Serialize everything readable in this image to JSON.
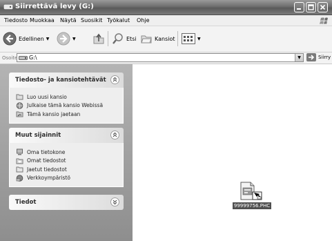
{
  "window": {
    "title": "Siirrettävä levy (G:)"
  },
  "menubar": {
    "items": [
      "Tiedosto",
      "Muokkaa",
      "Näytä",
      "Suosikit",
      "Työkalut",
      "Ohje"
    ]
  },
  "toolbar": {
    "back_label": "Edellinen",
    "search_label": "Etsi",
    "folders_label": "Kansiot"
  },
  "address": {
    "label": "Osoite",
    "value": "G:\\",
    "go_label": "Siirry"
  },
  "panels": {
    "file_tasks": {
      "title": "Tiedosto- ja kansiotehtävät",
      "items": [
        "Luo uusi kansio",
        "Julkaise tämä kansio Webissä",
        "Tämä kansio jaetaan"
      ]
    },
    "other_places": {
      "title": "Muut sijainnit",
      "items": [
        "Oma tietokone",
        "Omat tiedostot",
        "Jaetut tiedostot",
        "Verkkoympäristö"
      ]
    },
    "details": {
      "title": "Tiedot"
    }
  },
  "files": [
    {
      "name": "99999756.PHC",
      "selected": true,
      "icon": "phc-file-icon"
    }
  ]
}
